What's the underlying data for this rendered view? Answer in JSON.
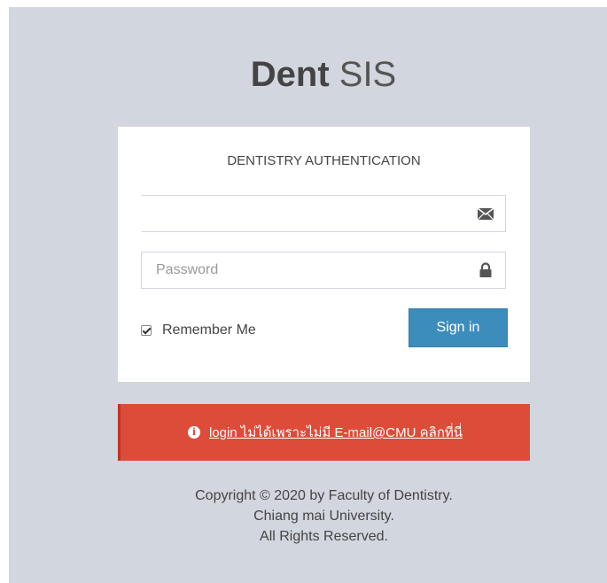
{
  "brand": {
    "bold": "Dent",
    "light": "SIS"
  },
  "card": {
    "title": "DENTISTRY AUTHENTICATION",
    "email": {
      "value": "",
      "placeholder": "",
      "icon": "envelope-icon"
    },
    "password": {
      "value": "",
      "placeholder": "Password",
      "icon": "lock-icon"
    },
    "remember": {
      "label": "Remember Me",
      "checked": true
    },
    "signin_label": "Sign in"
  },
  "alert": {
    "icon": "info-circle-icon",
    "text": "login ไม่ได้เพราะไม่มี E-mail@CMU คลิกที่นี่",
    "color": "#dd4b39"
  },
  "footer": {
    "line1": "Copyright © 2020 by Faculty of Dentistry.",
    "line2": "Chiang mai University.",
    "line3": "All Rights Reserved."
  },
  "colors": {
    "background": "#d2d6de",
    "primary": "#3c8dbc",
    "danger": "#dd4b39"
  }
}
